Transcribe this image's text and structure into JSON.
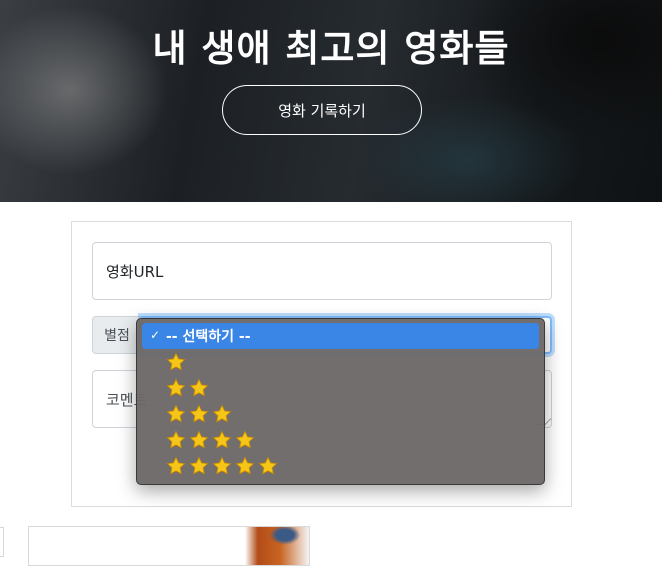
{
  "hero": {
    "title": "내 생애 최고의 영화들",
    "record_button_label": "영화 기록하기"
  },
  "form": {
    "url_field_value": "영화URL",
    "star_label": "별점",
    "comment_placeholder": "코멘트",
    "star_select": {
      "selected_index": 0,
      "options": [
        {
          "label": "-- 선택하기 --",
          "stars": 0
        },
        {
          "label": "",
          "stars": 1
        },
        {
          "label": "",
          "stars": 2
        },
        {
          "label": "",
          "stars": 3
        },
        {
          "label": "",
          "stars": 4
        },
        {
          "label": "",
          "stars": 5
        }
      ],
      "check_mark": "✓"
    }
  },
  "colors": {
    "selected_option": "#3a86e6",
    "dropdown_bg": "#6c6868",
    "focus_border": "#80bdff",
    "star_gold": "#f5c518"
  },
  "icons": {
    "star": "star-icon",
    "check": "check-icon"
  }
}
